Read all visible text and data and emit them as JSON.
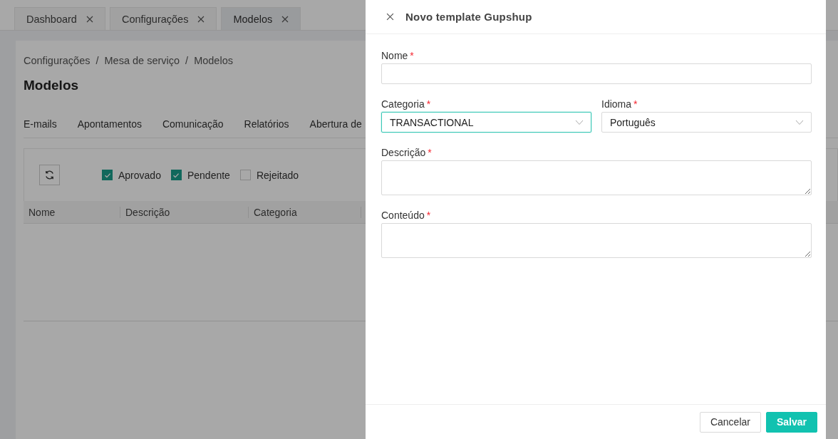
{
  "tabs": [
    {
      "label": "Dashboard",
      "selected": false
    },
    {
      "label": "Configurações",
      "selected": false
    },
    {
      "label": "Modelos",
      "selected": true
    }
  ],
  "breadcrumb": [
    "Configurações",
    "Mesa de serviço",
    "Modelos"
  ],
  "breadcrumb_separator": "/",
  "page_title": "Modelos",
  "nav_tabs": [
    "E-mails",
    "Apontamentos",
    "Comunicação",
    "Relatórios",
    "Abertura de"
  ],
  "filters": [
    {
      "label": "Aprovado",
      "checked": true
    },
    {
      "label": "Pendente",
      "checked": true
    },
    {
      "label": "Rejeitado",
      "checked": false
    }
  ],
  "table": {
    "columns": [
      "Nome",
      "Descrição",
      "Categoria"
    ]
  },
  "drawer": {
    "title": "Novo template Gupshup",
    "fields": [
      {
        "kind": "text",
        "label": "Nome",
        "required_mark": "*",
        "focused": false
      },
      {
        "kind": "select",
        "label": "Categoria",
        "required_mark": "*",
        "value": "TRANSACTIONAL",
        "focused": true
      },
      {
        "kind": "select",
        "label": "Idioma",
        "required_mark": "*",
        "value": "Português",
        "focused": false
      },
      {
        "kind": "textarea",
        "label": "Descrição",
        "required_mark": "*",
        "focused": false
      },
      {
        "kind": "textarea",
        "label": "Conteúdo",
        "required_mark": "*",
        "focused": false
      }
    ],
    "buttons": [
      {
        "kind": "secondary",
        "label": "Cancelar"
      },
      {
        "kind": "primary",
        "label": "Salvar"
      }
    ]
  }
}
